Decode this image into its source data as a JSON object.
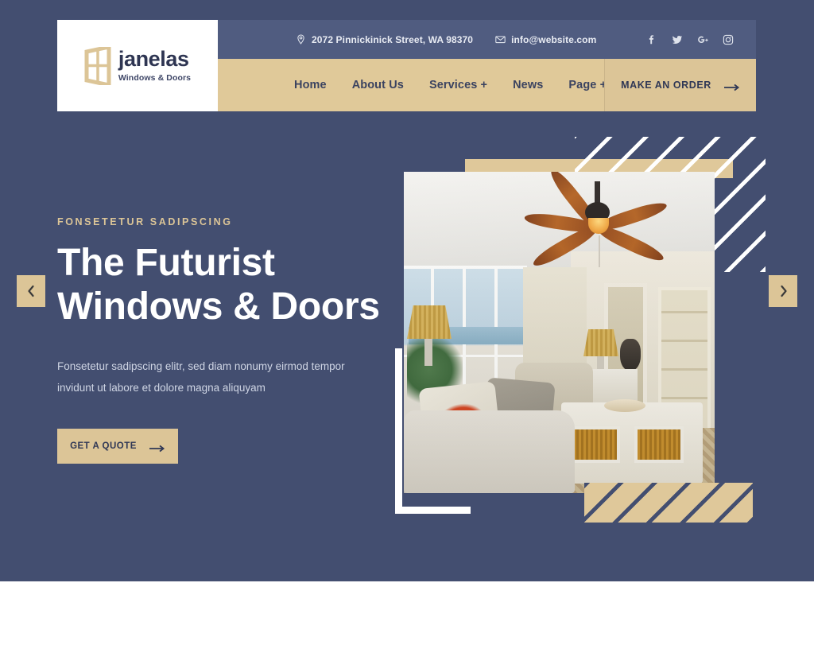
{
  "brand": {
    "name": "janelas",
    "tagline": "Windows & Doors",
    "logo_icon": "window-frame-icon"
  },
  "topbar": {
    "address": "2072 Pinnickinick Street, WA 98370",
    "address_icon": "location-pin-icon",
    "email": "info@website.com",
    "email_icon": "envelope-icon",
    "social": [
      {
        "name": "facebook-icon",
        "label": "f"
      },
      {
        "name": "twitter-icon",
        "label": "t"
      },
      {
        "name": "google-plus-icon",
        "label": "G+"
      },
      {
        "name": "instagram-icon",
        "label": "ig"
      }
    ]
  },
  "nav": {
    "items": [
      {
        "label": "Home",
        "has_dropdown": false
      },
      {
        "label": "About Us",
        "has_dropdown": false
      },
      {
        "label": "Services +",
        "has_dropdown": true
      },
      {
        "label": "News",
        "has_dropdown": false
      },
      {
        "label": "Page +",
        "has_dropdown": true
      }
    ],
    "cta_label": "MAKE AN ORDER",
    "cta_icon": "arrow-right-icon"
  },
  "hero": {
    "eyebrow": "FONSETETUR SADIPSCING",
    "title_line1": "The Futurist",
    "title_line2": "Windows & Doors",
    "subtitle_line1": "Fonsetetur sadipscing elitr, sed diam nonumy eirmod tempor",
    "subtitle_line2": "invidunt ut labore et dolore magna aliquyam",
    "cta_label": "GET A QUOTE",
    "cta_icon": "arrow-right-icon",
    "prev_icon": "chevron-left-icon",
    "next_icon": "chevron-right-icon",
    "image_alt": "living-room-interior-with-ceiling-fan-and-windows"
  },
  "colors": {
    "navy": "#434e70",
    "navy_light": "#505c80",
    "tan": "#dcc597",
    "tan_light": "#e0c999",
    "text_dark": "#2f3755",
    "white": "#ffffff"
  }
}
